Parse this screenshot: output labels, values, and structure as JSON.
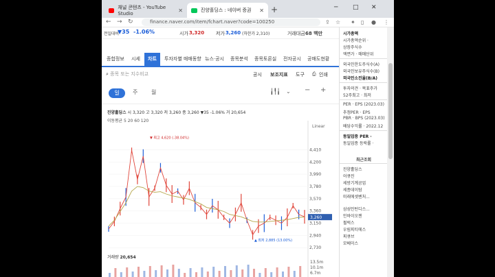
{
  "browser": {
    "tabs": [
      {
        "label": "채널 콘텐츠 - YouTube Studio",
        "color": "#ff0000"
      },
      {
        "label": "진양홀딩스 : 네이버 증권",
        "color": "#03c75a"
      }
    ],
    "new_tab": "+",
    "url": "finance.naver.com/item/fchart.naver?code=100250",
    "window_controls": [
      "─",
      "□",
      "✕"
    ]
  },
  "stock_header": {
    "prev_label": "전일대비",
    "change_value": "▼35",
    "change_pct": "-1.06%",
    "high_label": "시가",
    "high_value": "3,320",
    "low_label": "저가",
    "low_value": "3,260",
    "limit_down": "(하한가 2,310)",
    "volume_label": "거래대금",
    "volume_value": "68 백만"
  },
  "nav": [
    "종합정보",
    "시세",
    "차트",
    "투자자별 매매동향",
    "뉴스·공시",
    "종목분석",
    "종목토론실",
    "전자공시",
    "공매도현황"
  ],
  "search": {
    "placeholder": "종목 또는 지수비교"
  },
  "tools": [
    "공시",
    "보조지표",
    "도구",
    "인쇄"
  ],
  "periods": [
    "일",
    "주",
    "월"
  ],
  "chart_info": {
    "name": "진양홀딩스",
    "ohlc": "시 3,320  고 3,320  저 3,260  종 3,260 ▼35 -1.06%  거 20,654",
    "ma": "이동평균 5 20 60 120",
    "scale": "Linear"
  },
  "chart_data": {
    "type": "line",
    "y_ticks": [
      "4,410",
      "4,200",
      "3,990",
      "3,780",
      "3,570",
      "3,360",
      "3,150",
      "2,940",
      "2,730"
    ],
    "current_price": "3,260",
    "max_label": "최고 4,620 (-38.04%)",
    "min_label": "최저 2,885 (13.00%)",
    "ylim": [
      2650,
      4650
    ],
    "series": [
      {
        "values": [
          3050,
          3180,
          3400,
          3600,
          4400,
          3900,
          4300,
          3600,
          3750,
          4100,
          3800,
          3650,
          3700,
          3550,
          3750,
          3500,
          3420,
          3300,
          3450,
          3380,
          3250,
          3150,
          3300,
          3500,
          3200,
          2950,
          3100,
          3150,
          3250,
          3200,
          3150,
          3250,
          3450,
          3300,
          3260
        ]
      },
      {
        "values": [
          3100,
          3200,
          3350,
          3500,
          3700,
          3780,
          3760,
          3700,
          3680,
          3690,
          3650,
          3620,
          3600,
          3580,
          3560,
          3520,
          3480,
          3420,
          3400,
          3380,
          3350,
          3300,
          3280,
          3260,
          3220,
          3180,
          3170,
          3170,
          3180,
          3190,
          3200,
          3210,
          3230,
          3250,
          3255
        ]
      }
    ],
    "volume_ticks": [
      "13.5m",
      "10.1m",
      "6.7m"
    ],
    "volume_label": "거래량",
    "volume_value": "20,654"
  },
  "sidebar": {
    "items": [
      {
        "text": "시가총액",
        "style": "hd"
      },
      {
        "text": "시가총액순위 ·",
        "style": ""
      },
      {
        "text": "상장주식수",
        "style": ""
      },
      {
        "text": "액면가 · 매매단위",
        "style": ""
      },
      {
        "text": "외국인한도주식수(A)",
        "style": ""
      },
      {
        "text": "외국인보유주식수(B)",
        "style": ""
      },
      {
        "text": "외국인소진율(B/A)",
        "style": "hd"
      },
      {
        "text": "투자의견 · 목표주가",
        "style": ""
      },
      {
        "text": "52주최고 · 최저",
        "style": ""
      },
      {
        "text": "PER · EPS (2023.03)",
        "style": ""
      },
      {
        "text": "추정PER · EPS",
        "style": ""
      },
      {
        "text": "PBR · BPS (2023.03)",
        "style": ""
      },
      {
        "text": "배당수익률 · 2022.12",
        "style": ""
      },
      {
        "text": "동일업종 PER ·",
        "style": "hd"
      },
      {
        "text": "동일업종 등락률 ·",
        "style": ""
      }
    ],
    "recent_label": "최근조회",
    "recent": [
      "진양홀딩스",
      "어큐진",
      "세방기계공업",
      "세종데이탐",
      "미래에셋벤처...",
      "삼성인턴디스...",
      "인바이오젠",
      "펄럭스",
      "우림피티에스",
      "피큐브",
      "모베이스"
    ]
  }
}
